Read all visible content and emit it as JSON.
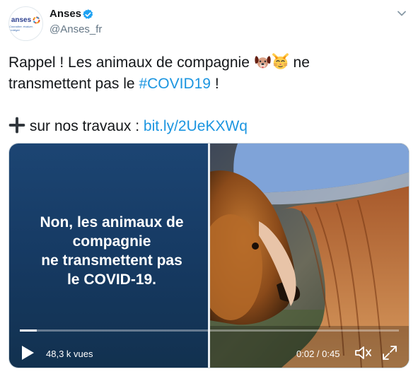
{
  "account": {
    "avatar_logo_text": "anses",
    "avatar_tagline": "Connaître, évaluer, protéger",
    "display_name": "Anses",
    "handle": "@Anses_fr",
    "verified_icon": "verified-badge-icon",
    "menu_icon": "chevron-down-icon"
  },
  "tweet": {
    "part1": "Rappel ! Les animaux de compagnie ",
    "emoji1": "dog-face-icon",
    "emoji2": "cat-face-icon",
    "part2": " ne",
    "part3": "transmettent pas le ",
    "hashtag": "#COVID19",
    "part4": " !",
    "plus_icon": "heavy-plus-icon",
    "part5": " sur nos travaux : ",
    "link": "bit.ly/2UeKXWq"
  },
  "video": {
    "overlay_lines": [
      "Non, les animaux de",
      "compagnie",
      "ne transmettent pas",
      "le COVID-19."
    ],
    "views": "48,3 k vues",
    "time": "0:02 / 0:45",
    "progress_fraction": 0.044,
    "play_icon": "play-icon",
    "volume_icon": "volume-muted-icon",
    "fullscreen_icon": "fullscreen-icon"
  },
  "colors": {
    "link": "#1b95e0",
    "verified": "#1da1f2",
    "video_panel": "#1c4573"
  }
}
